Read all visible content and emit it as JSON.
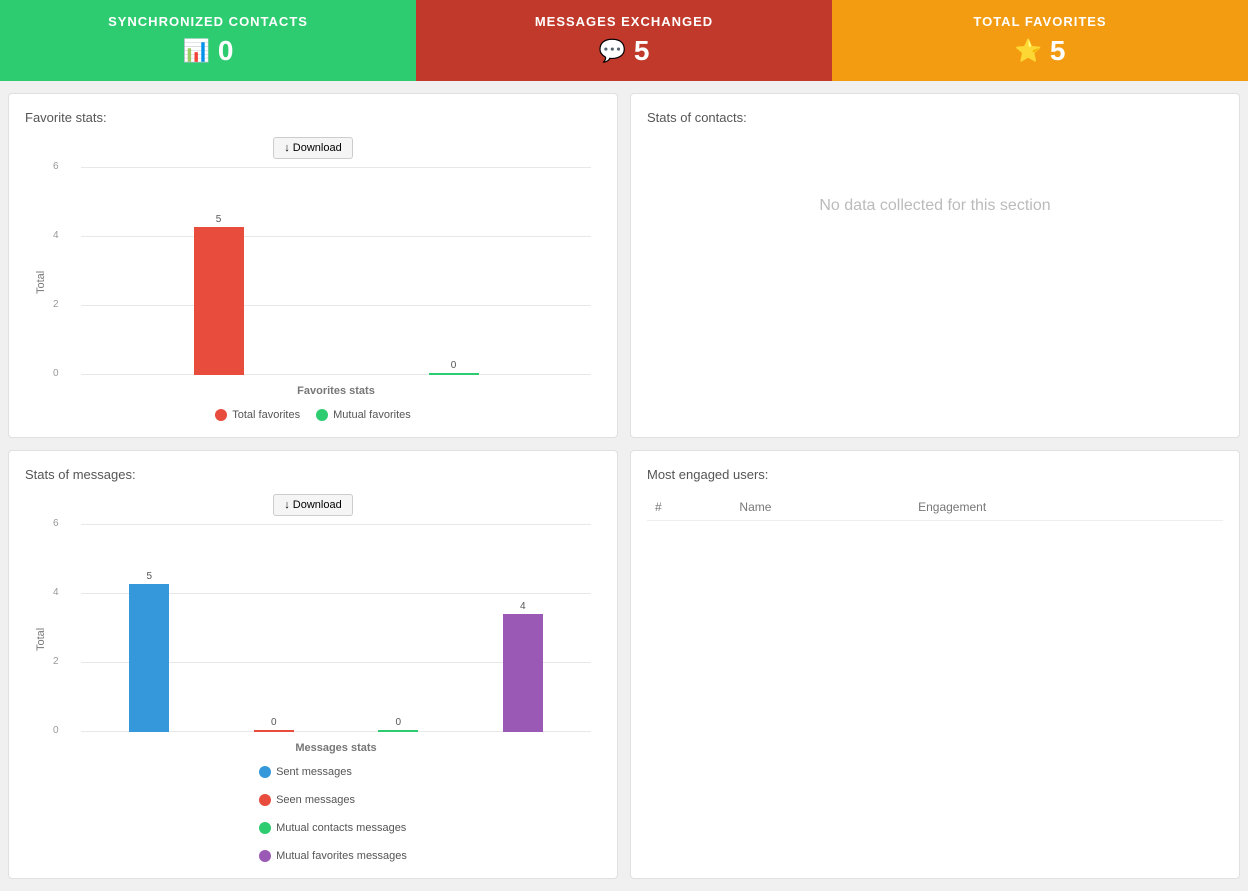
{
  "topCards": [
    {
      "id": "synchronized-contacts",
      "colorClass": "green",
      "title": "SYNCHRONIZED CONTACTS",
      "icon": "📊",
      "iconSymbol": "bar-chart",
      "value": "0"
    },
    {
      "id": "messages-exchanged",
      "colorClass": "red",
      "title": "MESSAGES EXCHANGED",
      "icon": "💬",
      "iconSymbol": "chat",
      "value": "5"
    },
    {
      "id": "total-favorites",
      "colorClass": "orange",
      "title": "TOTAL FAVORITES",
      "icon": "⭐",
      "iconSymbol": "star",
      "value": "5"
    }
  ],
  "favoriteStats": {
    "title": "Favorite stats:",
    "downloadLabel": "↓ Download",
    "xAxisLabel": "Favorites stats",
    "yAxisLabel": "Total",
    "yTicks": [
      "6",
      "4",
      "2",
      "0"
    ],
    "bars": [
      {
        "label": "Total favorites",
        "value": 5,
        "color": "#e74c3c",
        "displayValue": "5"
      },
      {
        "label": "Mutual favorites",
        "value": 0,
        "color": "#2ecc71",
        "displayValue": "0"
      }
    ],
    "legend": [
      {
        "label": "Total favorites",
        "color": "#e74c3c"
      },
      {
        "label": "Mutual favorites",
        "color": "#2ecc71"
      }
    ]
  },
  "statsOfContacts": {
    "title": "Stats of contacts:",
    "noDataText": "No data collected for this section"
  },
  "statsOfMessages": {
    "title": "Stats of messages:",
    "downloadLabel": "↓ Download",
    "xAxisLabel": "Messages stats",
    "yAxisLabel": "Total",
    "yTicks": [
      "6",
      "4",
      "2",
      "0"
    ],
    "bars": [
      {
        "label": "Sent messages",
        "value": 5,
        "color": "#3498db",
        "displayValue": "5"
      },
      {
        "label": "Seen messages",
        "value": 0,
        "color": "#e74c3c",
        "displayValue": "0"
      },
      {
        "label": "Mutual contacts messages",
        "value": 0,
        "color": "#2ecc71",
        "displayValue": "0"
      },
      {
        "label": "Mutual favorites messages",
        "value": 4,
        "color": "#9b59b6",
        "displayValue": "4"
      }
    ],
    "legend": [
      {
        "label": "Sent messages",
        "color": "#3498db"
      },
      {
        "label": "Seen messages",
        "color": "#e74c3c"
      },
      {
        "label": "Mutual contacts messages",
        "color": "#2ecc71"
      },
      {
        "label": "Mutual favorites messages",
        "color": "#9b59b6"
      }
    ]
  },
  "mostEngagedUsers": {
    "title": "Most engaged users:",
    "columns": [
      "#",
      "Name",
      "Engagement"
    ]
  }
}
